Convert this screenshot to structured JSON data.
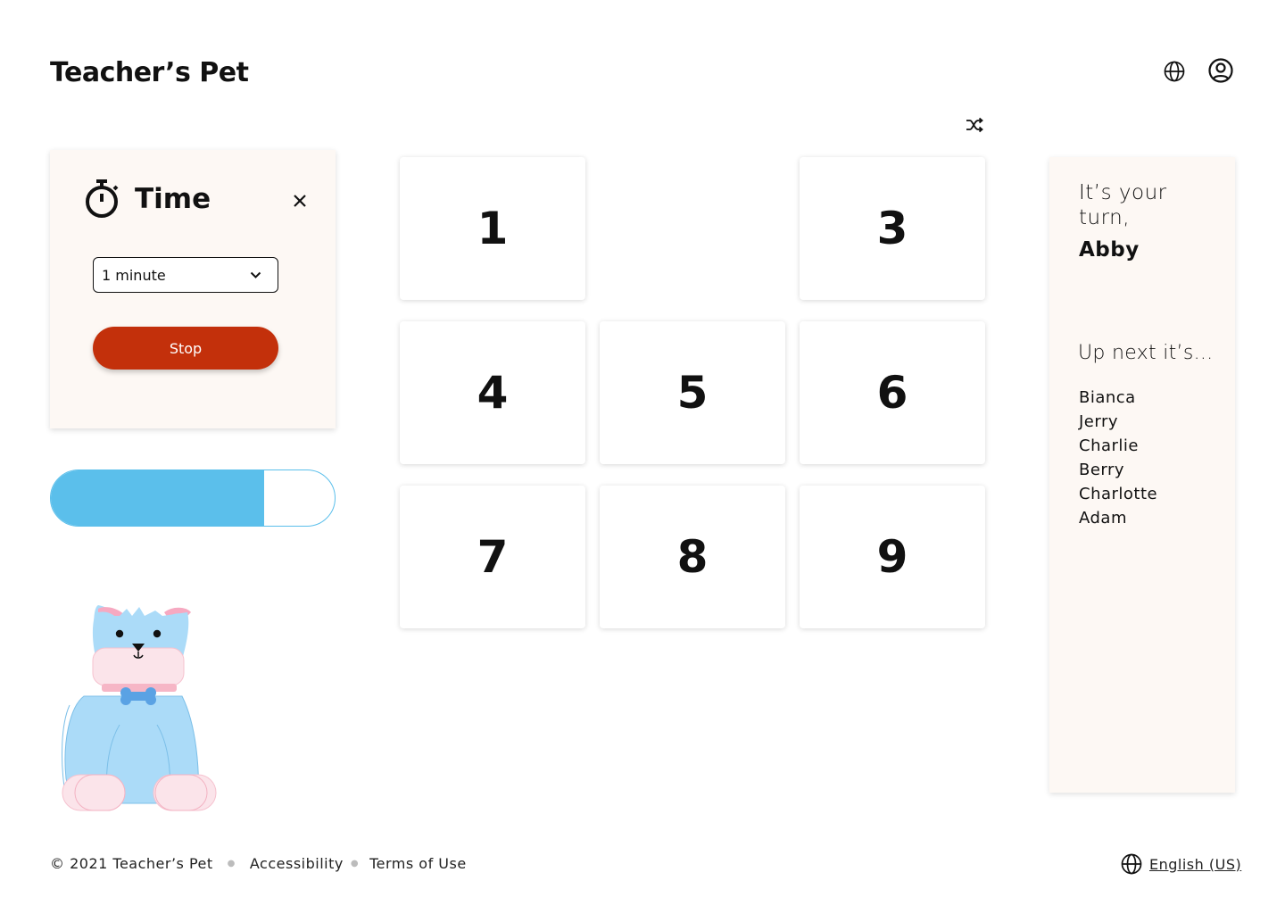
{
  "app": {
    "title": "Teacher’s Pet"
  },
  "header": {
    "language_icon": "globe-icon",
    "account_icon": "user-circle-icon",
    "shuffle_icon": "shuffle-icon"
  },
  "timer": {
    "icon": "stopwatch-icon",
    "title": "Time",
    "close_icon": "close-icon",
    "duration": {
      "selected": "1 minute",
      "icon": "chevron-down-icon"
    },
    "stop_label": "Stop",
    "progress": 0.75
  },
  "grid": {
    "tiles": [
      "1",
      "",
      "3",
      "4",
      "5",
      "6",
      "7",
      "8",
      "9"
    ]
  },
  "turn": {
    "label": "It’s your turn,",
    "current": "Abby",
    "next_label": "Up next it’s...",
    "queue": [
      "Bianca",
      "Jerry",
      "Charlie",
      "Berry",
      "Charlotte",
      "Adam"
    ]
  },
  "footer": {
    "copyright": "© 2021 Teacher’s Pet",
    "links": [
      "Accessibility",
      "Terms of Use"
    ],
    "language": "English (US)",
    "language_icon": "globe-icon"
  },
  "colors": {
    "accent_red": "#c3300b",
    "progress_blue": "#5bbfeb",
    "panel_bg": "#fdf8f4"
  }
}
